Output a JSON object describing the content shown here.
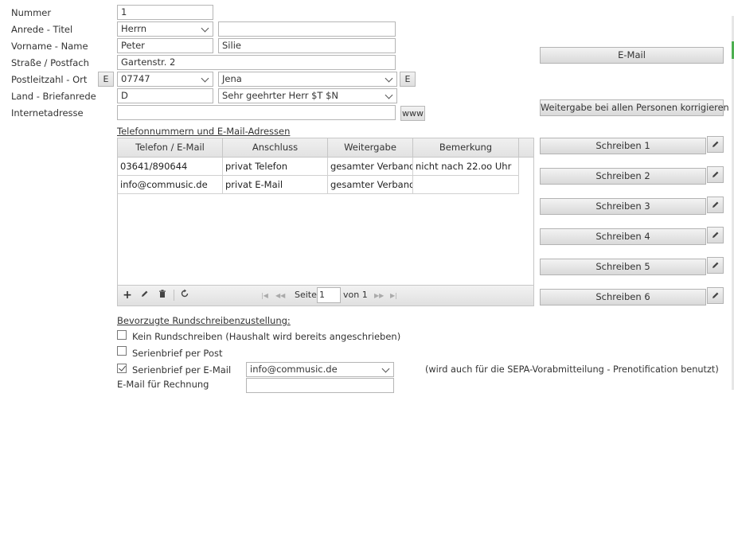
{
  "labels": {
    "nummer": "Nummer",
    "anrede_titel": "Anrede - Titel",
    "vorname_name": "Vorname - Name",
    "strasse": "Straße / Postfach",
    "plz_ort": "Postleitzahl - Ort",
    "land_brief": "Land - Briefanrede",
    "internet": "Internetadresse"
  },
  "fields": {
    "nummer": "1",
    "anrede": "Herrn",
    "titel": "",
    "vorname": "Peter",
    "name": "Silie",
    "strasse": "Gartenstr. 2",
    "plz": "07747",
    "ort": "Jena",
    "land": "D",
    "briefanrede": "Sehr geehrter Herr $T $N",
    "internet": ""
  },
  "small_buttons": {
    "e_left": "E",
    "e_right": "E",
    "www": "www"
  },
  "right_buttons": {
    "email": "E-Mail",
    "weitergabe": "Weitergabe bei allen Personen korrigieren",
    "schreiben": [
      "Schreiben 1",
      "Schreiben 2",
      "Schreiben 3",
      "Schreiben 4",
      "Schreiben 5",
      "Schreiben 6"
    ]
  },
  "phone_section": {
    "title": "Telefonnummern und E-Mail-Adressen",
    "columns": [
      "Telefon / E-Mail",
      "Anschluss",
      "Weitergabe",
      "Bemerkung"
    ],
    "rows": [
      [
        "03641/890644",
        "privat Telefon",
        "gesamter Verband",
        "nicht nach 22.oo Uhr"
      ],
      [
        "info@commusic.de",
        "privat E-Mail",
        "gesamter Verband",
        ""
      ]
    ],
    "pager": {
      "seite": "Seite",
      "page": "1",
      "von": "von 1"
    }
  },
  "rundschreiben": {
    "title": "Bevorzugte Rundschreibenzustellung:",
    "kein": "Kein Rundschreiben (Haushalt wird bereits angeschrieben)",
    "post": "Serienbrief per Post",
    "email": "Serienbrief per E-Mail",
    "email_value": "info@commusic.de",
    "sepa_note": "(wird auch für die SEPA-Vorabmitteilung - Prenotification benutzt)",
    "rechnung_label": "E-Mail für Rechnung",
    "rechnung_value": "",
    "kein_checked": false,
    "post_checked": false,
    "email_checked": true
  }
}
